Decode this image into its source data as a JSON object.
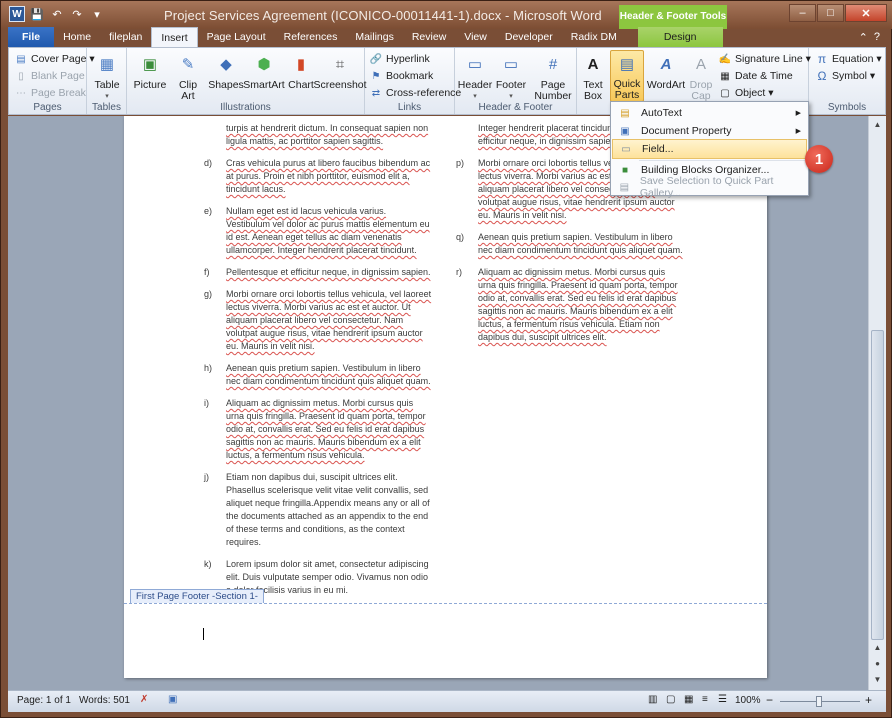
{
  "window": {
    "title": "Project Services Agreement (ICONICO-00011441-1).docx  -  Microsoft Word",
    "context_tools": "Header & Footer Tools",
    "controls": {
      "minimize": "–",
      "maximize": "□",
      "close": "✕"
    }
  },
  "qat": {
    "logo": "W",
    "save": "💾",
    "undo": "↶",
    "redo": "↷",
    "customize": "▾"
  },
  "tabs": [
    "File",
    "Home",
    "fileplan",
    "Insert",
    "Page Layout",
    "References",
    "Mailings",
    "Review",
    "View",
    "Developer",
    "Radix DM"
  ],
  "context_tab": "Design",
  "ribbon": {
    "pages": {
      "label": "Pages",
      "cover_page": "Cover Page ▾",
      "blank_page": "Blank Page",
      "page_break": "Page Break"
    },
    "tables": {
      "label": "Tables",
      "table": "Table"
    },
    "illustrations": {
      "label": "Illustrations",
      "picture": "Picture",
      "clip_art": "Clip Art",
      "shapes": "Shapes",
      "smartart": "SmartArt",
      "chart": "Chart",
      "screenshot": "Screenshot"
    },
    "links": {
      "label": "Links",
      "hyperlink": "Hyperlink",
      "bookmark": "Bookmark",
      "cross_reference": "Cross-reference"
    },
    "header_footer": {
      "label": "Header & Footer",
      "header": "Header",
      "footer": "Footer",
      "page_number": "Page Number"
    },
    "text": {
      "text_box": "Text Box",
      "quick_parts": "Quick Parts",
      "wordart": "WordArt",
      "drop_cap": "Drop Cap",
      "signature_line": "Signature Line ▾",
      "date_time": "Date & Time",
      "object": "Object ▾"
    },
    "symbols": {
      "label": "Symbols",
      "equation": "Equation ▾",
      "symbol": "Symbol ▾"
    }
  },
  "quick_parts_menu": {
    "items": [
      {
        "label": "AutoText",
        "submenu": true
      },
      {
        "label": "Document Property",
        "submenu": true
      },
      {
        "label": "Field...",
        "submenu": false
      },
      {
        "label": "Building Blocks Organizer...",
        "submenu": false
      },
      {
        "label": "Save Selection to Quick Part Gallery...",
        "submenu": false
      }
    ]
  },
  "callout_number": "1",
  "document": {
    "left_top": {
      "line1": "turpis at hendrerit dictum. In consequat sapien non",
      "line2": "ligula mattis, ac porttitor sapien sagittis."
    },
    "left_items": [
      {
        "label": "d)",
        "text": "Cras vehicula purus at libero faucibus bibendum ac at purus. Proin et nibh porttitor, euismod elit a, tincidunt lacus."
      },
      {
        "label": "e)",
        "text": "Nullam eget est id lacus vehicula varius. Vestibulum vel dolor ac purus mattis elementum eu id est. Aenean eget tellus ac diam venenatis ullamcorper. Integer hendrerit placerat tincidunt."
      },
      {
        "label": "f)",
        "text": "Pellentesque et efficitur neque, in dignissim sapien."
      },
      {
        "label": "g)",
        "text": "Morbi ornare orci lobortis tellus vehicula, vel laoreet lectus viverra. Morbi varius ac est et auctor. Ut aliquam placerat libero vel consectetur. Nam volutpat augue risus, vitae hendrerit ipsum auctor eu. Mauris in velit nisi."
      },
      {
        "label": "h)",
        "text": "Aenean quis pretium sapien. Vestibulum in libero nec diam condimentum tincidunt quis aliquet quam."
      },
      {
        "label": "i)",
        "text": "Aliquam ac dignissim metus. Morbi cursus quis urna quis fringilla. Praesent id quam porta, tempor odio at, convallis erat. Sed eu felis id erat dapibus sagittis non ac mauris. Mauris bibendum ex a elit luctus, a fermentum risus vehicula."
      },
      {
        "label": "j)",
        "text": "Etiam non dapibus dui, suscipit ultrices elit. Phasellus scelerisque velit vitae velit convallis, sed aliquet neque fringilla.Appendix means any or all of the documents attached as an appendix to the end of these terms and conditions, as the context requires."
      },
      {
        "label": "k)",
        "text": "Lorem ipsum dolor sit amet, consectetur adipiscing elit. Duis vulputate semper odio. Vivamus non odio a dolor facilisis varius in eu mi."
      }
    ],
    "right_top": {
      "line1": "Integer hendrerit placerat tincidunt. Pellentesque et",
      "line2": "efficitur neque, in dignissim sapien."
    },
    "right_items": [
      {
        "label": "p)",
        "text": "Morbi ornare orci lobortis tellus vehicula, vel laoreet lectus viverra. Morbi varius ac est et auctor. Ut aliquam placerat libero vel consectetur. Nam volutpat augue risus, vitae hendrerit ipsum auctor eu. Mauris in velit nisi."
      },
      {
        "label": "q)",
        "text": "Aenean quis pretium sapien. Vestibulum in libero nec diam condimentum tincidunt quis aliquet quam."
      },
      {
        "label": "r)",
        "text": "Aliquam ac dignissim metus. Morbi cursus quis urna quis fringilla. Praesent id quam porta, tempor odio at, convallis erat. Sed eu felis id erat dapibus sagittis non ac mauris. Mauris bibendum ex a elit luctus, a fermentum risus vehicula. Etiam non dapibus dui, suscipit ultrices elit."
      }
    ],
    "footer_tag": "First Page Footer -Section 1-"
  },
  "statusbar": {
    "page": "Page: 1 of 1",
    "words": "Words: 501",
    "zoom": "100%",
    "zoom_out": "−",
    "zoom_in": "+"
  },
  "colors": {
    "accent": "#2b579a",
    "context": "#8cc63f",
    "callout": "#d13a2b"
  }
}
